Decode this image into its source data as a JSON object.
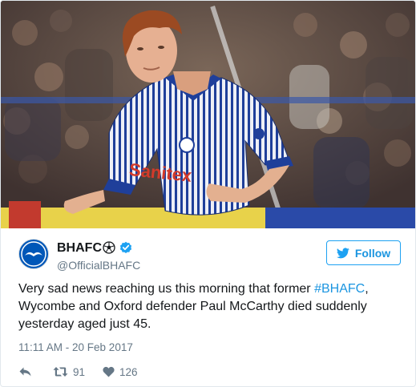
{
  "account": {
    "display_name": "BHAFC",
    "handle": "@OfficialBHAFC",
    "avatar_icon": "seagull-crest-icon",
    "badges": [
      "football-icon",
      "verified-icon"
    ]
  },
  "follow_button": {
    "label": "Follow",
    "icon": "bird-icon"
  },
  "tweet": {
    "text_before": "Very sad news reaching us this morning that former ",
    "hashtag": "#BHAFC",
    "text_after": ", Wycombe and Oxford defender Paul McCarthy died suddenly yesterday aged just 45.",
    "timestamp": "11:11 AM - 20 Feb 2017"
  },
  "actions": {
    "reply_icon": "reply-icon",
    "retweet_icon": "retweet-icon",
    "retweet_count": "91",
    "like_icon": "heart-icon",
    "like_count": "126"
  },
  "media": {
    "kit_sponsor_text": "Sanitex"
  },
  "colors": {
    "brand_blue": "#0057b8",
    "link_blue": "#1b95e0",
    "muted_gray": "#657786",
    "text_dark": "#14171a"
  }
}
